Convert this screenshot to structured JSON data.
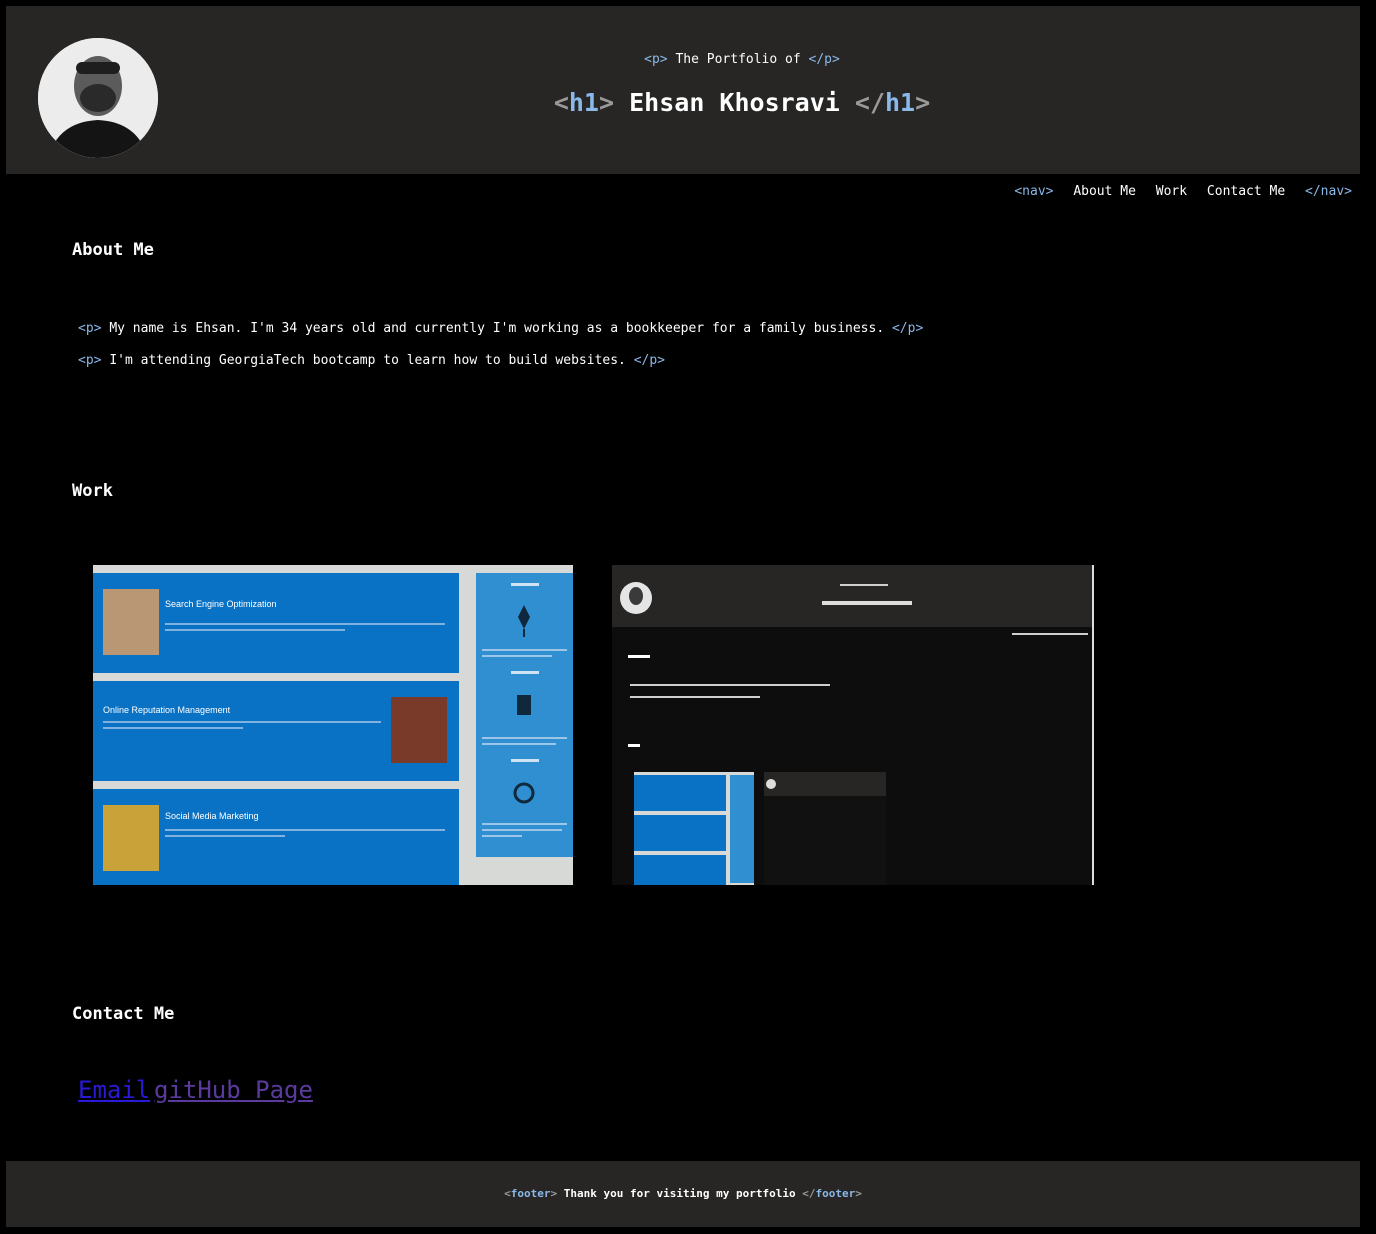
{
  "header": {
    "subtitle_open": "<p>",
    "subtitle": "The Portfolio of",
    "subtitle_close": "</p>",
    "title_open_bracket": "<",
    "title_open_tag": "h1",
    "title_open_end": ">",
    "title": "Ehsan Khosravi",
    "title_close_bracket": "</",
    "title_close_tag": "h1",
    "title_close_end": ">"
  },
  "nav": {
    "open_tag": "<nav>",
    "items": [
      "About Me",
      "Work",
      "Contact Me"
    ],
    "close_tag": "</nav>"
  },
  "about": {
    "heading": "About Me",
    "p_open": "<p>",
    "p_close": "</p>",
    "paragraphs": [
      "My name is Ehsan. I'm 34 years old and currently I'm working as a bookkeeper for a family business.",
      "I'm attending GeorgiaTech bootcamp to learn how to build websites."
    ]
  },
  "work": {
    "heading": "Work",
    "shot1": {
      "cards": [
        "Search Engine Optimization",
        "Online Reputation Management",
        "Social Media Marketing"
      ]
    }
  },
  "contact": {
    "heading": "Contact Me",
    "email_label": "Email",
    "github_label": "gitHub Page"
  },
  "footer": {
    "open_tag": "footer",
    "text": "Thank you for visiting my portfolio",
    "close_tag": "footer"
  },
  "colors": {
    "header_bg": "#272625",
    "tag": "#8ab8e8",
    "card_blue": "#0a72c4"
  }
}
